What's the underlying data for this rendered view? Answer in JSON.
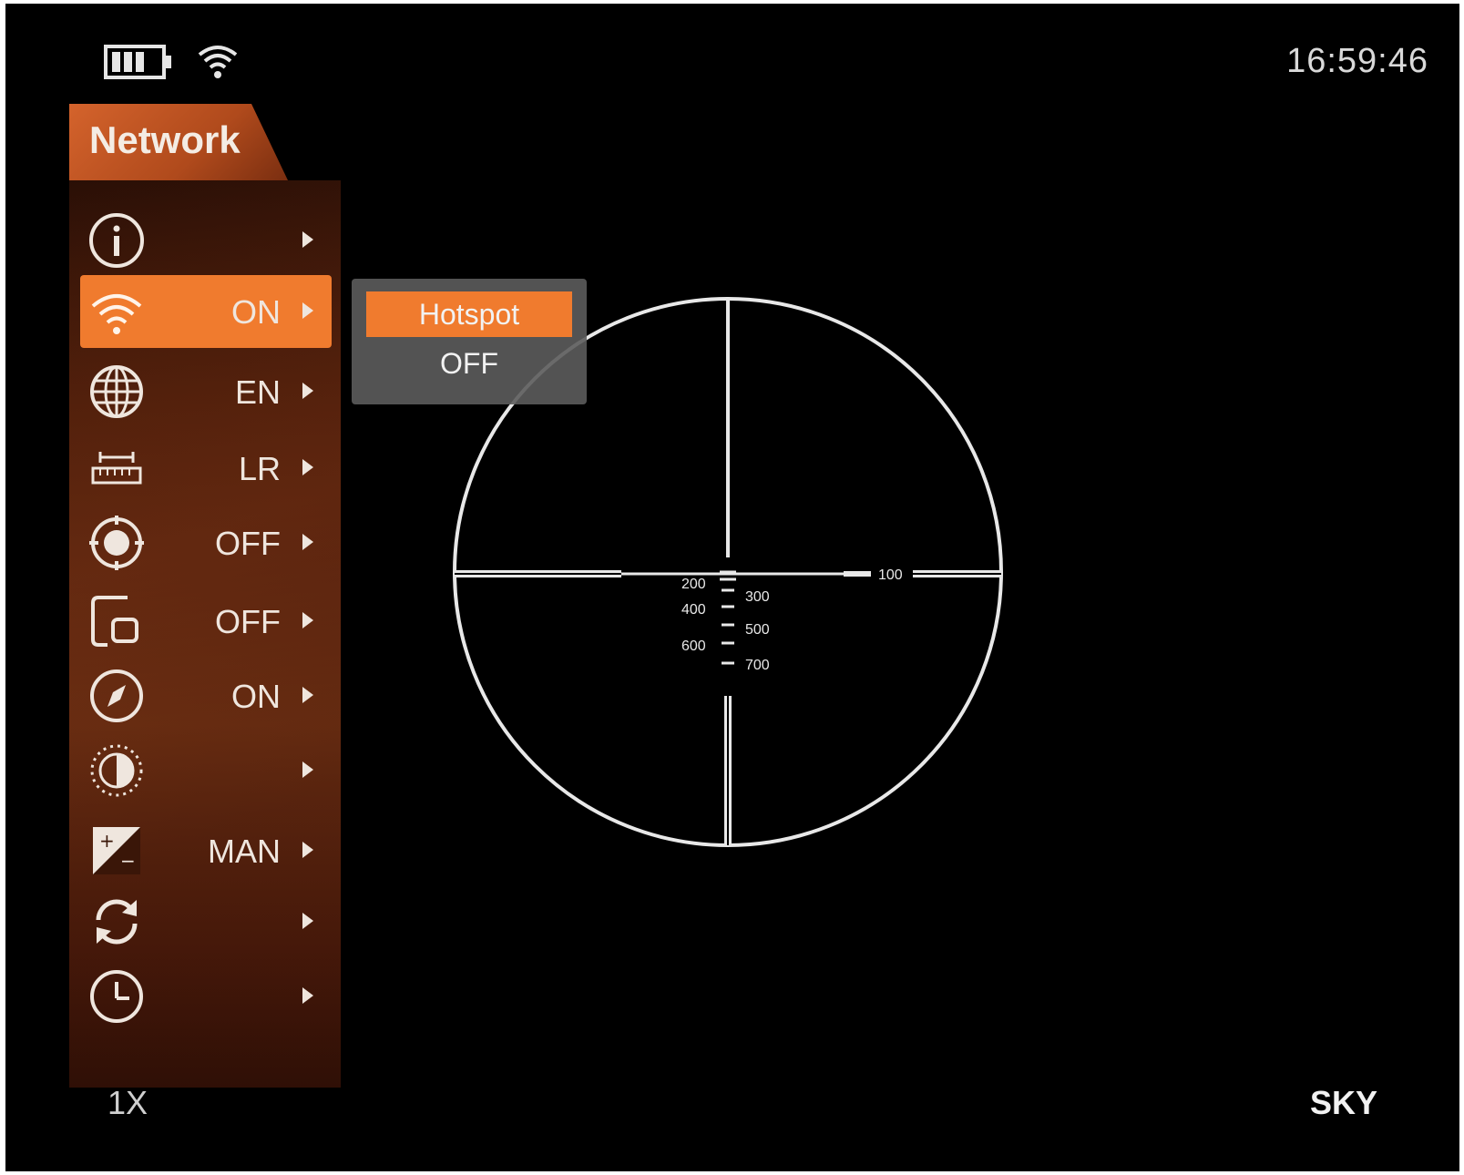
{
  "status": {
    "battery_icon": "battery-icon",
    "wifi_icon": "wifi-icon",
    "time": "16:59:46"
  },
  "menu": {
    "title": "Network",
    "items": [
      {
        "icon": "info-icon",
        "value": ""
      },
      {
        "icon": "wifi-icon",
        "value": "ON",
        "selected": true
      },
      {
        "icon": "globe-icon",
        "value": "EN"
      },
      {
        "icon": "ruler-icon",
        "value": "LR"
      },
      {
        "icon": "target-icon",
        "value": "OFF"
      },
      {
        "icon": "pip-icon",
        "value": "OFF"
      },
      {
        "icon": "compass-icon",
        "value": "ON"
      },
      {
        "icon": "contrast-icon",
        "value": ""
      },
      {
        "icon": "exposure-icon",
        "value": "MAN"
      },
      {
        "icon": "refresh-icon",
        "value": ""
      },
      {
        "icon": "clock-icon",
        "value": ""
      }
    ]
  },
  "submenu": {
    "options": [
      "Hotspot",
      "OFF"
    ],
    "selected": "Hotspot"
  },
  "reticle": {
    "labels": [
      "100",
      "200",
      "300",
      "400",
      "500",
      "600",
      "700"
    ]
  },
  "bottom": {
    "zoom": "1X",
    "palette": "SKY"
  },
  "colors": {
    "accent": "#f07b2e",
    "text": "#efe6de",
    "background": "#000000"
  }
}
